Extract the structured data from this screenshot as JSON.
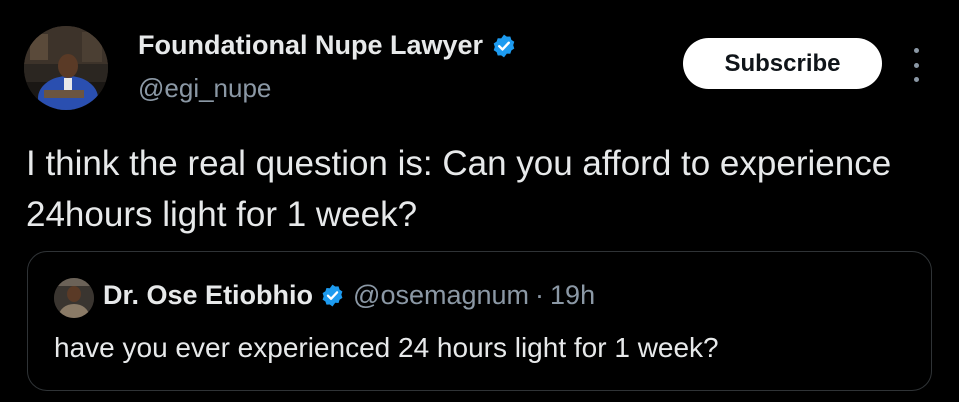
{
  "tweet": {
    "author_name": "Foundational Nupe Lawyer",
    "author_handle": "@egi_nupe",
    "subscribe_label": "Subscribe",
    "text": "I think the real question is: Can you afford to experience 24hours light for 1 week?"
  },
  "quote": {
    "author_name": "Dr. Ose Etiobhio",
    "author_handle": "@osemagnum",
    "separator": "·",
    "time": "19h",
    "text": "have you ever experienced 24 hours light for 1 week?"
  },
  "colors": {
    "background": "#000000",
    "primary_text": "#e7e9ea",
    "secondary_text": "#8b98a5",
    "verified_badge": "#1d9bf0",
    "subscribe_bg": "#ffffff",
    "border": "#2f3336"
  },
  "icons": {
    "verified": "verified-badge-icon",
    "more": "more-options-icon"
  }
}
